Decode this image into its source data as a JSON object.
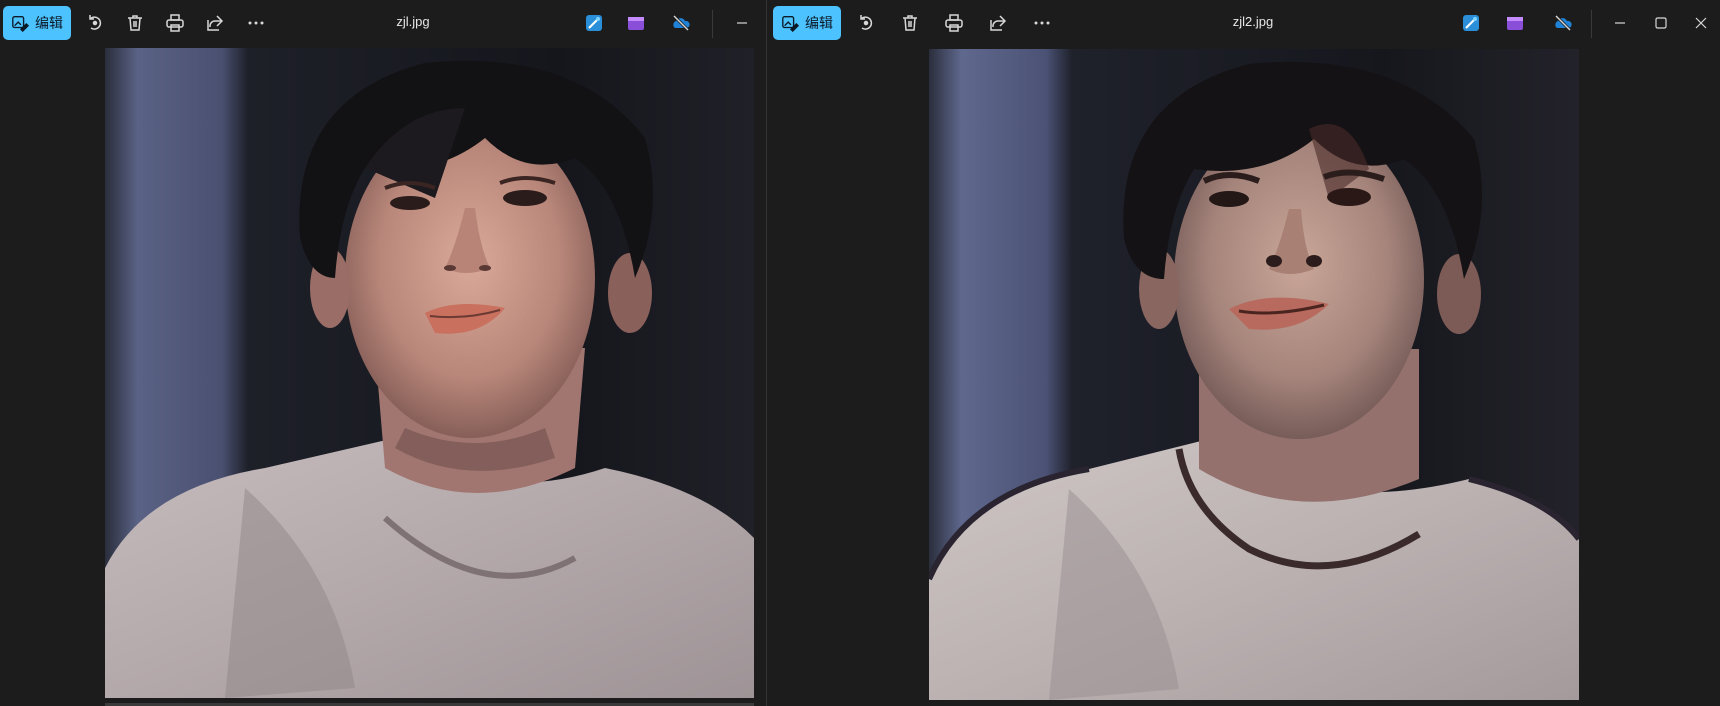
{
  "left_window": {
    "title": "zjl.jpg",
    "edit_label": "编辑",
    "toolbar_icons": [
      "rotate-icon",
      "delete-icon",
      "print-icon",
      "share-icon",
      "more-icon",
      "image-edit-icon",
      "video-editor-icon",
      "onedrive-icon",
      "minimize-icon"
    ],
    "photo_alt": "zjl.jpg"
  },
  "right_window": {
    "title": "zjl2.jpg",
    "edit_label": "编辑",
    "toolbar_icons": [
      "rotate-icon",
      "delete-icon",
      "print-icon",
      "share-icon",
      "more-icon",
      "image-edit-icon",
      "video-editor-icon",
      "onedrive-icon",
      "minimize-icon",
      "maximize-icon",
      "close-icon"
    ],
    "photo_alt": "zjl2.jpg"
  },
  "colors": {
    "accent": "#4cc2ff",
    "background": "#1c1c1c",
    "text": "#e6e6e6"
  }
}
